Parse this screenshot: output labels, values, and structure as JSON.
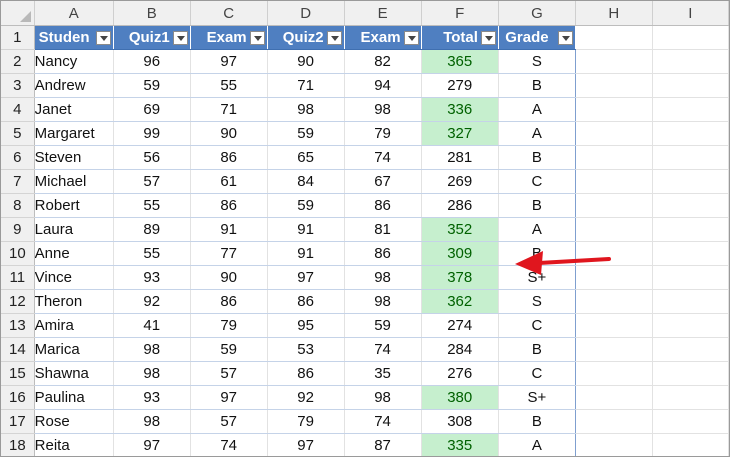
{
  "columns": [
    "A",
    "B",
    "C",
    "D",
    "E",
    "F",
    "G",
    "H",
    "I"
  ],
  "table_headers": [
    "Studen",
    "Quiz1",
    "Exam",
    "Quiz2",
    "Exam",
    "Total",
    "Grade"
  ],
  "rows": [
    {
      "num": "1"
    },
    {
      "num": "2",
      "name": "Nancy",
      "quiz1": "96",
      "exam1": "97",
      "quiz2": "90",
      "exam2": "82",
      "total": "365",
      "grade": "S",
      "hl": true
    },
    {
      "num": "3",
      "name": "Andrew",
      "quiz1": "59",
      "exam1": "55",
      "quiz2": "71",
      "exam2": "94",
      "total": "279",
      "grade": "B",
      "hl": false
    },
    {
      "num": "4",
      "name": "Janet",
      "quiz1": "69",
      "exam1": "71",
      "quiz2": "98",
      "exam2": "98",
      "total": "336",
      "grade": "A",
      "hl": true
    },
    {
      "num": "5",
      "name": "Margaret",
      "quiz1": "99",
      "exam1": "90",
      "quiz2": "59",
      "exam2": "79",
      "total": "327",
      "grade": "A",
      "hl": true
    },
    {
      "num": "6",
      "name": "Steven",
      "quiz1": "56",
      "exam1": "86",
      "quiz2": "65",
      "exam2": "74",
      "total": "281",
      "grade": "B",
      "hl": false
    },
    {
      "num": "7",
      "name": "Michael",
      "quiz1": "57",
      "exam1": "61",
      "quiz2": "84",
      "exam2": "67",
      "total": "269",
      "grade": "C",
      "hl": false
    },
    {
      "num": "8",
      "name": "Robert",
      "quiz1": "55",
      "exam1": "86",
      "quiz2": "59",
      "exam2": "86",
      "total": "286",
      "grade": "B",
      "hl": false
    },
    {
      "num": "9",
      "name": "Laura",
      "quiz1": "89",
      "exam1": "91",
      "quiz2": "91",
      "exam2": "81",
      "total": "352",
      "grade": "A",
      "hl": true
    },
    {
      "num": "10",
      "name": "Anne",
      "quiz1": "55",
      "exam1": "77",
      "quiz2": "91",
      "exam2": "86",
      "total": "309",
      "grade": "B",
      "hl": true
    },
    {
      "num": "11",
      "name": "Vince",
      "quiz1": "93",
      "exam1": "90",
      "quiz2": "97",
      "exam2": "98",
      "total": "378",
      "grade": "S+",
      "hl": true
    },
    {
      "num": "12",
      "name": "Theron",
      "quiz1": "92",
      "exam1": "86",
      "quiz2": "86",
      "exam2": "98",
      "total": "362",
      "grade": "S",
      "hl": true
    },
    {
      "num": "13",
      "name": "Amira",
      "quiz1": "41",
      "exam1": "79",
      "quiz2": "95",
      "exam2": "59",
      "total": "274",
      "grade": "C",
      "hl": false
    },
    {
      "num": "14",
      "name": "Marica",
      "quiz1": "98",
      "exam1": "59",
      "quiz2": "53",
      "exam2": "74",
      "total": "284",
      "grade": "B",
      "hl": false
    },
    {
      "num": "15",
      "name": "Shawna",
      "quiz1": "98",
      "exam1": "57",
      "quiz2": "86",
      "exam2": "35",
      "total": "276",
      "grade": "C",
      "hl": false
    },
    {
      "num": "16",
      "name": "Paulina",
      "quiz1": "93",
      "exam1": "97",
      "quiz2": "92",
      "exam2": "98",
      "total": "380",
      "grade": "S+",
      "hl": true
    },
    {
      "num": "17",
      "name": "Rose",
      "quiz1": "98",
      "exam1": "57",
      "quiz2": "79",
      "exam2": "74",
      "total": "308",
      "grade": "B",
      "hl": false
    },
    {
      "num": "18",
      "name": "Reita",
      "quiz1": "97",
      "exam1": "74",
      "quiz2": "97",
      "exam2": "87",
      "total": "335",
      "grade": "A",
      "hl": true
    }
  ],
  "colors": {
    "table_header": "#4f7fc1",
    "highlight_fill": "#c6efce",
    "highlight_text": "#006100",
    "arrow": "#e0161e"
  },
  "annotation": {
    "pointer": "red-arrow-icon"
  }
}
